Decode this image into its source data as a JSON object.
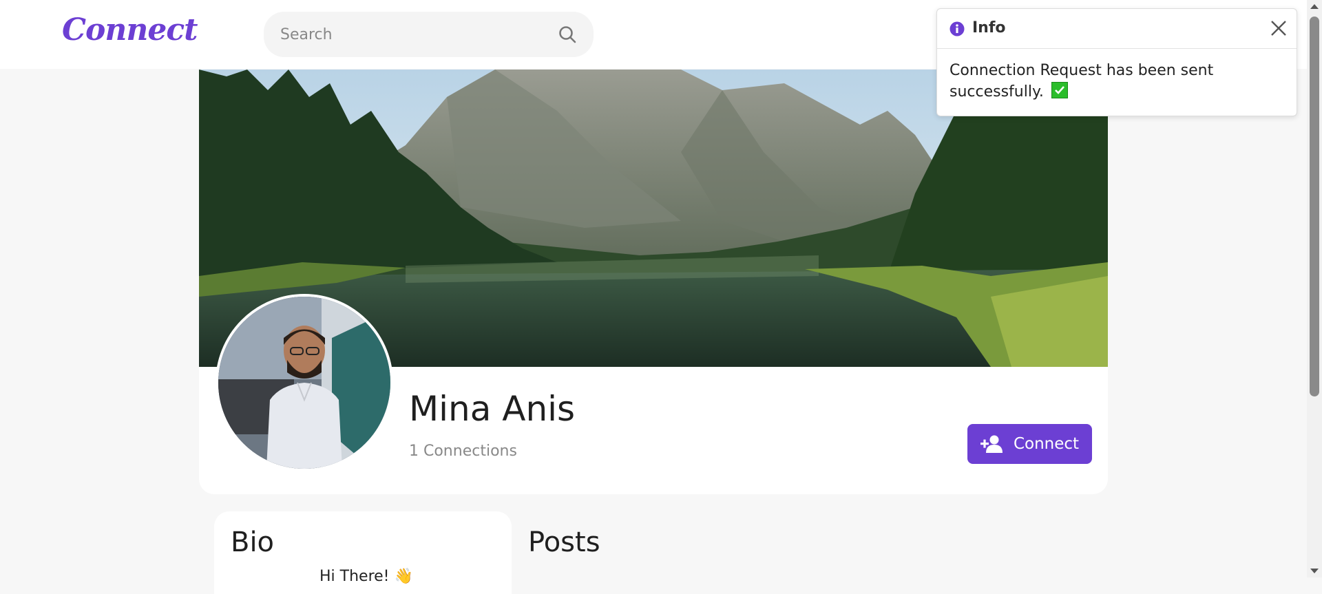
{
  "header": {
    "logo_text": "Connect",
    "search": {
      "placeholder": "Search",
      "value": ""
    }
  },
  "profile": {
    "name": "Mina Anis",
    "connections_text": "1 Connections",
    "connect_button_label": "Connect",
    "accent_color": "#6c3fd3"
  },
  "bio": {
    "title": "Bio",
    "text": "Hi There! 👋"
  },
  "posts": {
    "title": "Posts"
  },
  "toast": {
    "title": "Info",
    "message": "Connection Request has been sent successfully.",
    "icons": [
      "info-icon",
      "close-icon",
      "check-mark-icon"
    ]
  }
}
